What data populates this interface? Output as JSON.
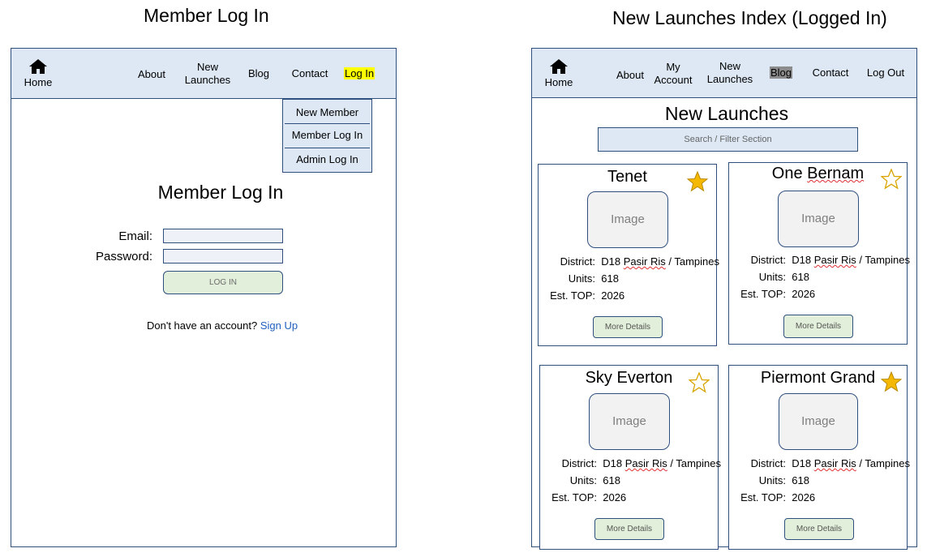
{
  "captions": {
    "left": "Member Log In",
    "right": "New Launches Index (Logged In)"
  },
  "left_nav": {
    "home": "Home",
    "about": "About",
    "new_launches_1": "New",
    "new_launches_2": "Launches",
    "blog": "Blog",
    "contact": "Contact",
    "login": "Log In",
    "highlight_color": "#ffff00"
  },
  "login_dropdown": {
    "new_member": "New Member",
    "member_login": "Member Log In",
    "admin_login": "Admin Log In"
  },
  "login_form": {
    "title": "Member Log In",
    "email_label": "Email:",
    "password_label": "Password:",
    "email_value": "",
    "password_value": "",
    "button": "LOG IN",
    "signup_prompt": "Don't have an account?",
    "signup_link": "Sign Up"
  },
  "right_nav": {
    "home": "Home",
    "about": "About",
    "my_account_1": "My",
    "my_account_2": "Account",
    "new_launches_1": "New",
    "new_launches_2": "Launches",
    "blog": "Blog",
    "contact": "Contact",
    "logout": "Log Out",
    "highlight_color": "#8c8c8c"
  },
  "launches": {
    "heading": "New Launches",
    "search_placeholder": "Search / Filter Section",
    "district_label": "District:",
    "units_label": "Units:",
    "top_label": "Est. TOP:",
    "image_label": "Image",
    "more_button": "More Details",
    "cards": [
      {
        "title_a": "Tenet",
        "title_b": "",
        "starred": true,
        "district_a": "D18",
        "district_b": "Pasir Ris",
        "district_c": "/ Tampines",
        "units": "618",
        "top": "2026"
      },
      {
        "title_a": "One ",
        "title_b": "Bernam",
        "starred": false,
        "district_a": "D18",
        "district_b": "Pasir Ris",
        "district_c": "/ Tampines",
        "units": "618",
        "top": "2026"
      },
      {
        "title_a": "Sky Everton",
        "title_b": "",
        "starred": false,
        "district_a": "D18",
        "district_b": "Pasir Ris",
        "district_c": "/ Tampines",
        "units": "618",
        "top": "2026"
      },
      {
        "title_a": "Piermont Grand",
        "title_b": "",
        "starred": true,
        "district_a": "D18",
        "district_b": "Pasir Ris",
        "district_c": "/ Tampines",
        "units": "618",
        "top": "2026"
      }
    ],
    "star_color": "#f5b800"
  }
}
